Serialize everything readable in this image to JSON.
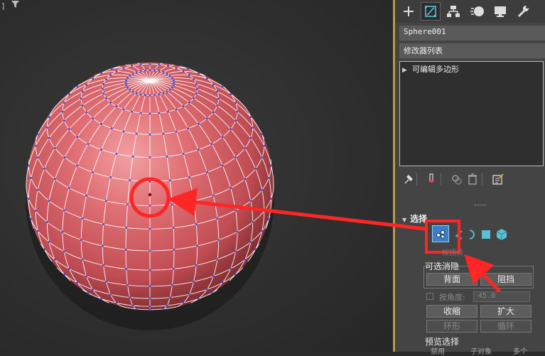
{
  "viewport": {
    "corner_label": "]",
    "filter_icon": "filter-icon"
  },
  "command_panel": {
    "tabs": [
      {
        "name": "create",
        "icon": "plus-icon"
      },
      {
        "name": "modify",
        "icon": "modify-icon",
        "active": true
      },
      {
        "name": "hierarchy",
        "icon": "hierarchy-icon"
      },
      {
        "name": "motion",
        "icon": "motion-icon"
      },
      {
        "name": "display",
        "icon": "display-icon"
      },
      {
        "name": "utilities",
        "icon": "wrench-icon"
      }
    ],
    "object_name": "Sphere001",
    "modifier_list": "修改器列表",
    "stack_items": [
      "可编辑多边形"
    ],
    "stack_tools": [
      "pin-stack-icon",
      "show-end-result-icon",
      "make-unique-icon",
      "remove-modifier-icon",
      "configure-sets-icon"
    ]
  },
  "selection": {
    "title": "选择",
    "levels": [
      {
        "name": "vertex",
        "icon": "vertex-icon",
        "active": true
      },
      {
        "name": "edge",
        "icon": "edge-icon"
      },
      {
        "name": "border",
        "icon": "border-icon"
      },
      {
        "name": "polygon",
        "icon": "polygon-icon"
      },
      {
        "name": "element",
        "icon": "element-icon"
      }
    ],
    "level_caption": "按顶点",
    "by_group_label": "可选消隐",
    "backface_button": "背面",
    "occluded_button": "阻挡",
    "angle_label": "按角度:",
    "angle_value": "45.0",
    "shrink_button": "收缩",
    "grow_button": "扩大",
    "ring_button": "环形",
    "loop_button": "循环",
    "preview_label": "预览选择",
    "preview_options": [
      "禁用",
      "子对象",
      "多个"
    ]
  },
  "colors": {
    "sphere": "#d9676c",
    "wire": "#ffffff",
    "vertex": "#4a4ae0",
    "highlight": "#ff2626",
    "active_button": "#3c7fc9",
    "panel_border": "#b99a4a"
  }
}
